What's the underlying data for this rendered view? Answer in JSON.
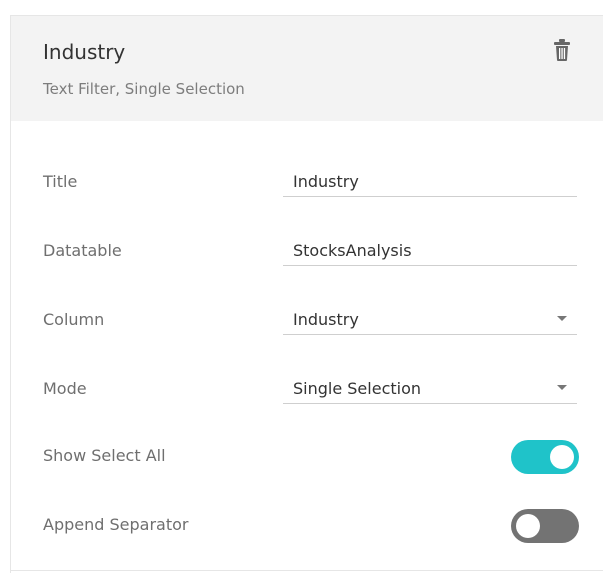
{
  "header": {
    "title": "Industry",
    "subtitle": "Text Filter, Single Selection",
    "delete_icon": "trash-icon"
  },
  "form": {
    "title": {
      "label": "Title",
      "value": "Industry"
    },
    "datatable": {
      "label": "Datatable",
      "value": "StocksAnalysis"
    },
    "column": {
      "label": "Column",
      "value": "Industry"
    },
    "mode": {
      "label": "Mode",
      "value": "Single Selection"
    },
    "show_select_all": {
      "label": "Show Select All",
      "enabled": true
    },
    "append_separator": {
      "label": "Append Separator",
      "enabled": false
    }
  },
  "colors": {
    "header_bg": "#f3f3f3",
    "toggle_on": "#1fc3c9",
    "toggle_off": "#737373"
  }
}
